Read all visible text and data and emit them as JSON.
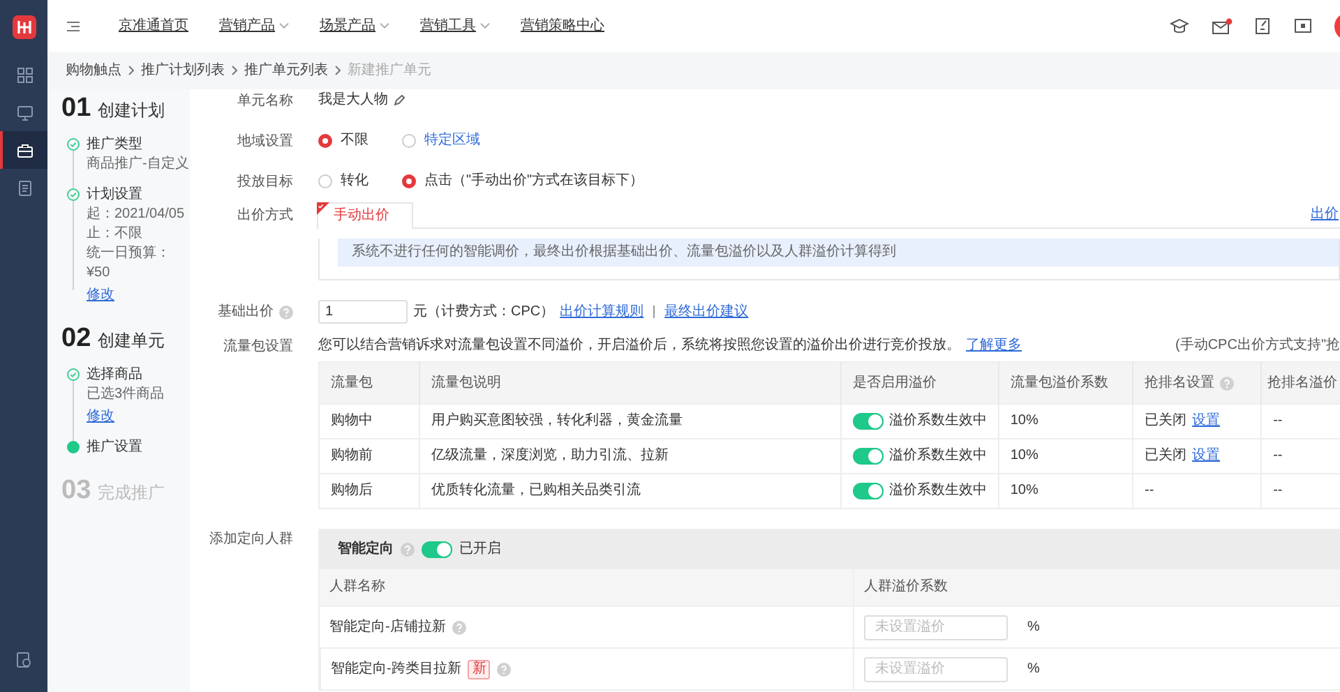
{
  "sidebar": {
    "items": [
      {
        "selected": false
      },
      {
        "selected": false
      },
      {
        "selected": true
      },
      {
        "selected": false
      }
    ]
  },
  "topnav": {
    "menu": [
      {
        "label": "京准通首页",
        "dropdown": false
      },
      {
        "label": "营销产品",
        "dropdown": true
      },
      {
        "label": "场景产品",
        "dropdown": true
      },
      {
        "label": "营销工具",
        "dropdown": true
      },
      {
        "label": "营销策略中心",
        "dropdown": false
      }
    ],
    "mail_unread": true
  },
  "breadcrumb": [
    {
      "label": "购物触点",
      "current": false
    },
    {
      "label": "推广计划列表",
      "current": false
    },
    {
      "label": "推广单元列表",
      "current": false
    },
    {
      "label": "新建推广单元",
      "current": true
    }
  ],
  "steps": [
    {
      "number": "01",
      "title": "创建计划",
      "active": true,
      "substeps": [
        {
          "title": "推广类型",
          "current": false,
          "lines": [
            "商品推广-自定义"
          ]
        },
        {
          "title": "计划设置",
          "current": false,
          "lines": [
            "起：2021/04/05",
            "止：不限",
            "统一日预算：",
            "¥50"
          ],
          "link": "修改"
        }
      ]
    },
    {
      "number": "02",
      "title": "创建单元",
      "active": true,
      "substeps": [
        {
          "title": "选择商品",
          "current": false,
          "lines": [
            "已选3件商品"
          ],
          "link": "修改"
        },
        {
          "title": "推广设置",
          "current": true
        }
      ]
    },
    {
      "number": "03",
      "title": "完成推广",
      "active": false
    }
  ],
  "form": {
    "unit_name": {
      "label": "单元名称",
      "value": "我是大人物"
    },
    "region": {
      "label": "地域设置",
      "options": [
        {
          "label": "不限",
          "selected": true,
          "is_link": false
        },
        {
          "label": "特定区域",
          "selected": false,
          "is_link": true
        }
      ]
    },
    "target": {
      "label": "投放目标",
      "options": [
        {
          "label": "转化",
          "selected": false,
          "is_link": false
        },
        {
          "label": "点击（\"手动出价\"方式在该目标下）",
          "selected": true,
          "is_link": false
        }
      ]
    },
    "bid_method": {
      "label": "出价方式",
      "tabs": [
        {
          "label": "手动出价",
          "selected": true
        }
      ],
      "corner_link": "出价",
      "notice": "系统不进行任何的智能调价，最终出价根据基础出价、流量包溢价以及人群溢价计算得到"
    },
    "base_bid": {
      "label": "基础出价",
      "value": "1",
      "unit": "元（计费方式：CPC）",
      "links": [
        "出价计算规则",
        "最终出价建议"
      ]
    },
    "traffic": {
      "label": "流量包设置",
      "description": "您可以结合营销诉求对流量包设置不同溢价，开启溢价后，系统将按照您设置的溢价出价进行竞价投放。",
      "learn_more": "了解更多",
      "note": "(手动CPC出价方式支持\"抢",
      "columns": [
        "流量包",
        "流量包说明",
        "是否启用溢价",
        "流量包溢价系数",
        "抢排名设置",
        "抢排名溢价"
      ],
      "rows": [
        {
          "name": "购物中",
          "desc": "用户购买意图较强，转化利器，黄金流量",
          "premium_on": true,
          "status": "溢价系数生效中",
          "coefficient": "10%",
          "rank_text": "已关闭",
          "rank_link": "设置",
          "rank_coef": "--"
        },
        {
          "name": "购物前",
          "desc": "亿级流量，深度浏览，助力引流、拉新",
          "premium_on": true,
          "status": "溢价系数生效中",
          "coefficient": "10%",
          "rank_text": "已关闭",
          "rank_link": "设置",
          "rank_coef": "--"
        },
        {
          "name": "购物后",
          "desc": "优质转化流量，已购相关品类引流",
          "premium_on": true,
          "status": "溢价系数生效中",
          "coefficient": "10%",
          "rank_text": "--",
          "rank_coef": "--"
        }
      ]
    },
    "crowd": {
      "label": "添加定向人群",
      "smart": {
        "label": "智能定向",
        "on": true,
        "status": "已开启"
      },
      "columns": [
        "人群名称",
        "人群溢价系数"
      ],
      "rows": [
        {
          "name": "智能定向-店铺拉新",
          "placeholder": "未设置溢价",
          "unit": "%"
        },
        {
          "name": "智能定向-跨类目拉新",
          "badge": "新",
          "placeholder": "未设置溢价",
          "unit": "%"
        }
      ]
    }
  }
}
